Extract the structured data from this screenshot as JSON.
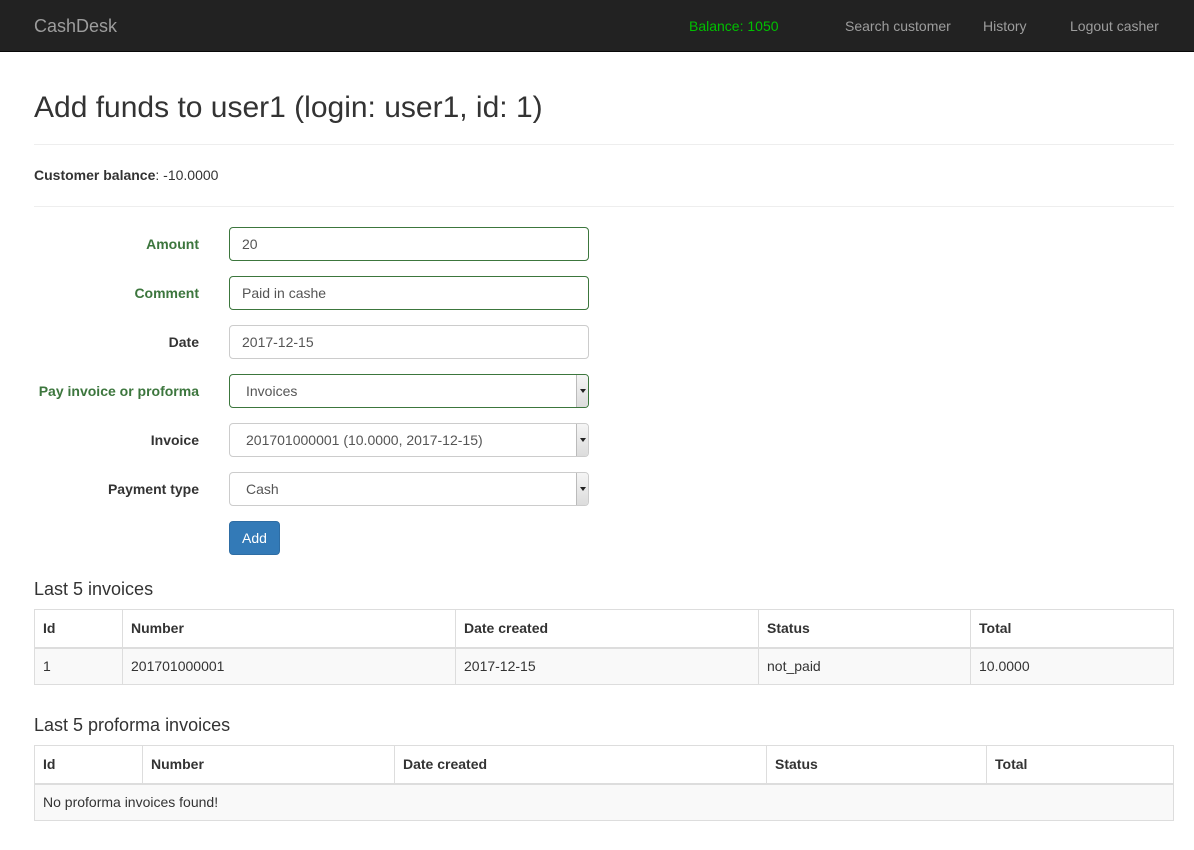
{
  "navbar": {
    "brand": "CashDesk",
    "balance": "Balance: 1050",
    "search": "Search customer",
    "history": "History",
    "logout": "Logout casher"
  },
  "page": {
    "title": "Add funds to user1 (login: user1, id: 1)",
    "balance_label": "Customer balance",
    "balance_value": ": -10.0000"
  },
  "form": {
    "amount_label": "Amount",
    "amount_value": "20",
    "comment_label": "Comment",
    "comment_value": "Paid in cashe",
    "date_label": "Date",
    "date_value": "2017-12-15",
    "pay_label": "Pay invoice or proforma",
    "pay_value": "Invoices",
    "invoice_label": "Invoice",
    "invoice_value": "201701000001 (10.0000, 2017-12-15)",
    "payment_type_label": "Payment type",
    "payment_type_value": "Cash",
    "add_button": "Add"
  },
  "invoices": {
    "title": "Last 5 invoices",
    "headers": [
      "Id",
      "Number",
      "Date created",
      "Status",
      "Total"
    ],
    "rows": [
      [
        "1",
        "201701000001",
        "2017-12-15",
        "not_paid",
        "10.0000"
      ]
    ]
  },
  "proforma": {
    "title": "Last 5 proforma invoices",
    "headers": [
      "Id",
      "Number",
      "Date created",
      "Status",
      "Total"
    ],
    "empty": "No proforma invoices found!"
  },
  "colors": {
    "navbar_bg": "#222222",
    "balance_green": "#00c000",
    "success_green": "#3c763d",
    "primary_blue": "#337ab7"
  }
}
